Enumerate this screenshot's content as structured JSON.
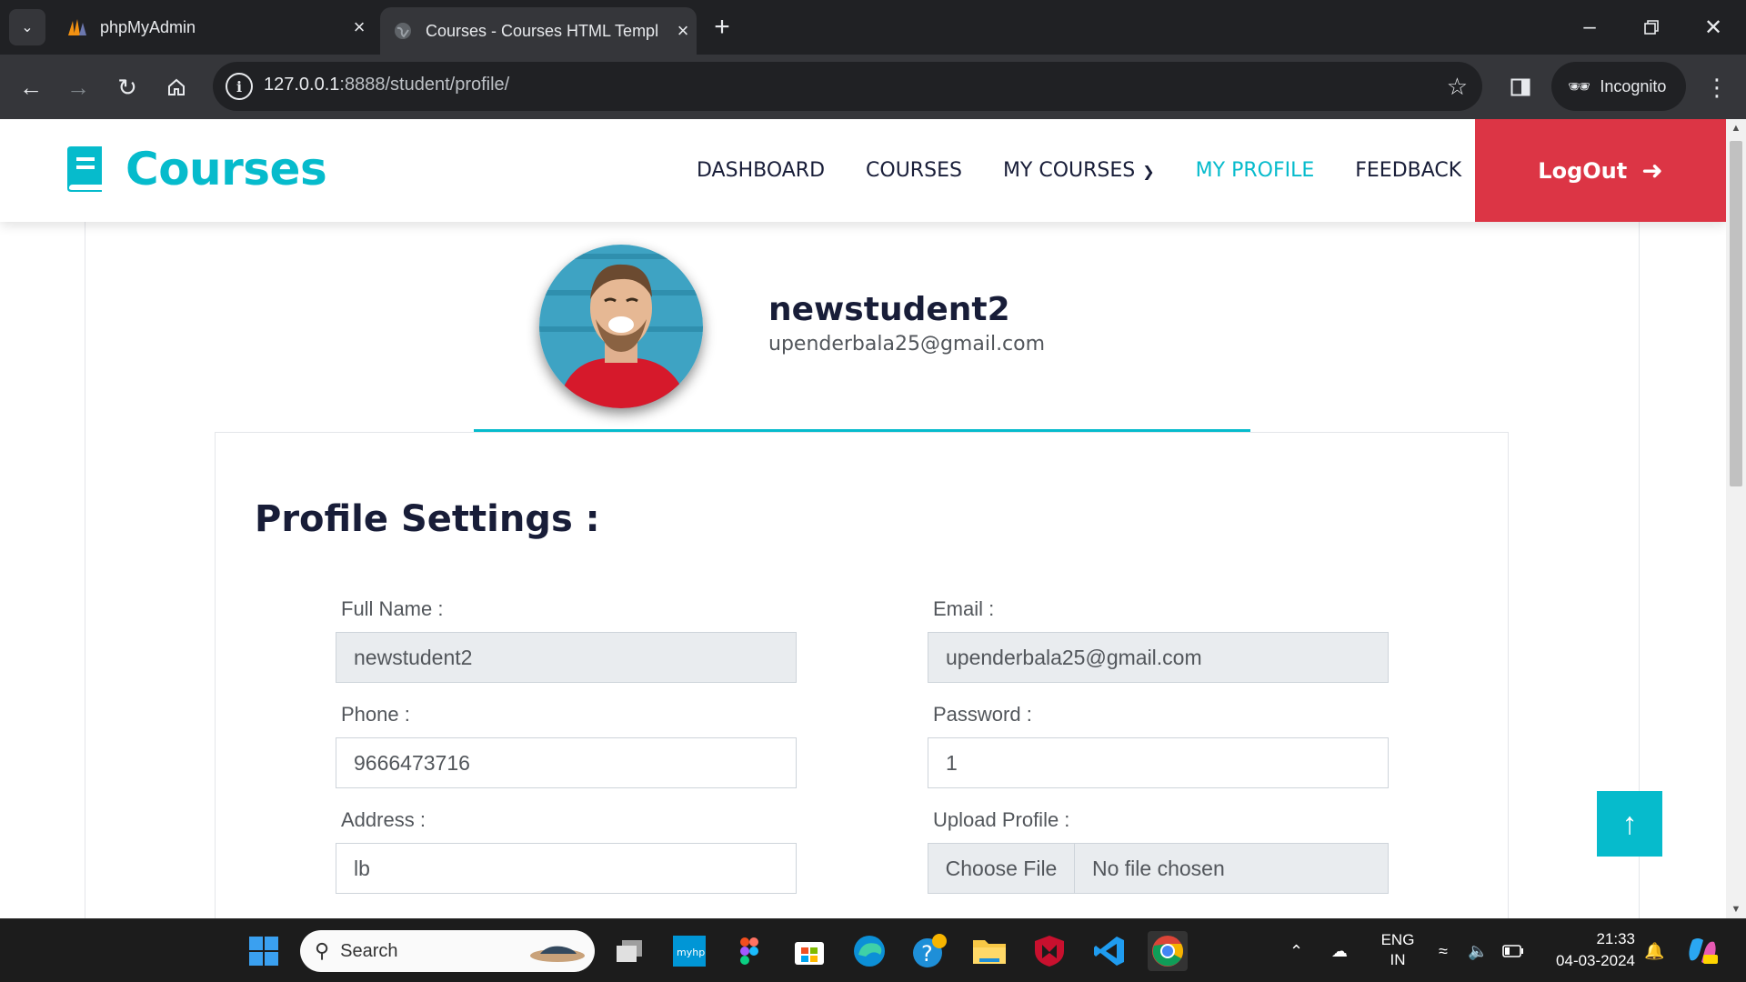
{
  "browser": {
    "tabs": [
      {
        "title": "phpMyAdmin",
        "active": false
      },
      {
        "title": "Courses - Courses HTML Templ",
        "active": true
      }
    ],
    "url_host": "127.0.0.1",
    "url_path": ":8888/student/profile/",
    "incognito_label": "Incognito"
  },
  "site": {
    "brand": "Courses",
    "nav": {
      "dashboard": "DASHBOARD",
      "courses": "COURSES",
      "my_courses": "MY COURSES",
      "my_profile": "MY PROFILE",
      "feedback": "FEEDBACK"
    },
    "logout": "LogOut",
    "colors": {
      "primary": "#06bbcc",
      "danger": "#dc3545",
      "dark": "#181d38"
    }
  },
  "profile": {
    "username": "newstudent2",
    "email": "upenderbala25@gmail.com",
    "settings_title": "Profile Settings :",
    "full_name_label": "Full Name :",
    "full_name_value": "newstudent2",
    "email_label": "Email :",
    "email_value": "upenderbala25@gmail.com",
    "phone_label": "Phone :",
    "phone_value": "9666473716",
    "password_label": "Password :",
    "password_value": "1",
    "address_label": "Address :",
    "address_value": "lb",
    "upload_label": "Upload Profile :",
    "choose_file": "Choose File",
    "no_file": "No file chosen"
  },
  "taskbar": {
    "search_placeholder": "Search",
    "lang_line1": "ENG",
    "lang_line2": "IN",
    "time": "21:33",
    "date": "04-03-2024"
  }
}
